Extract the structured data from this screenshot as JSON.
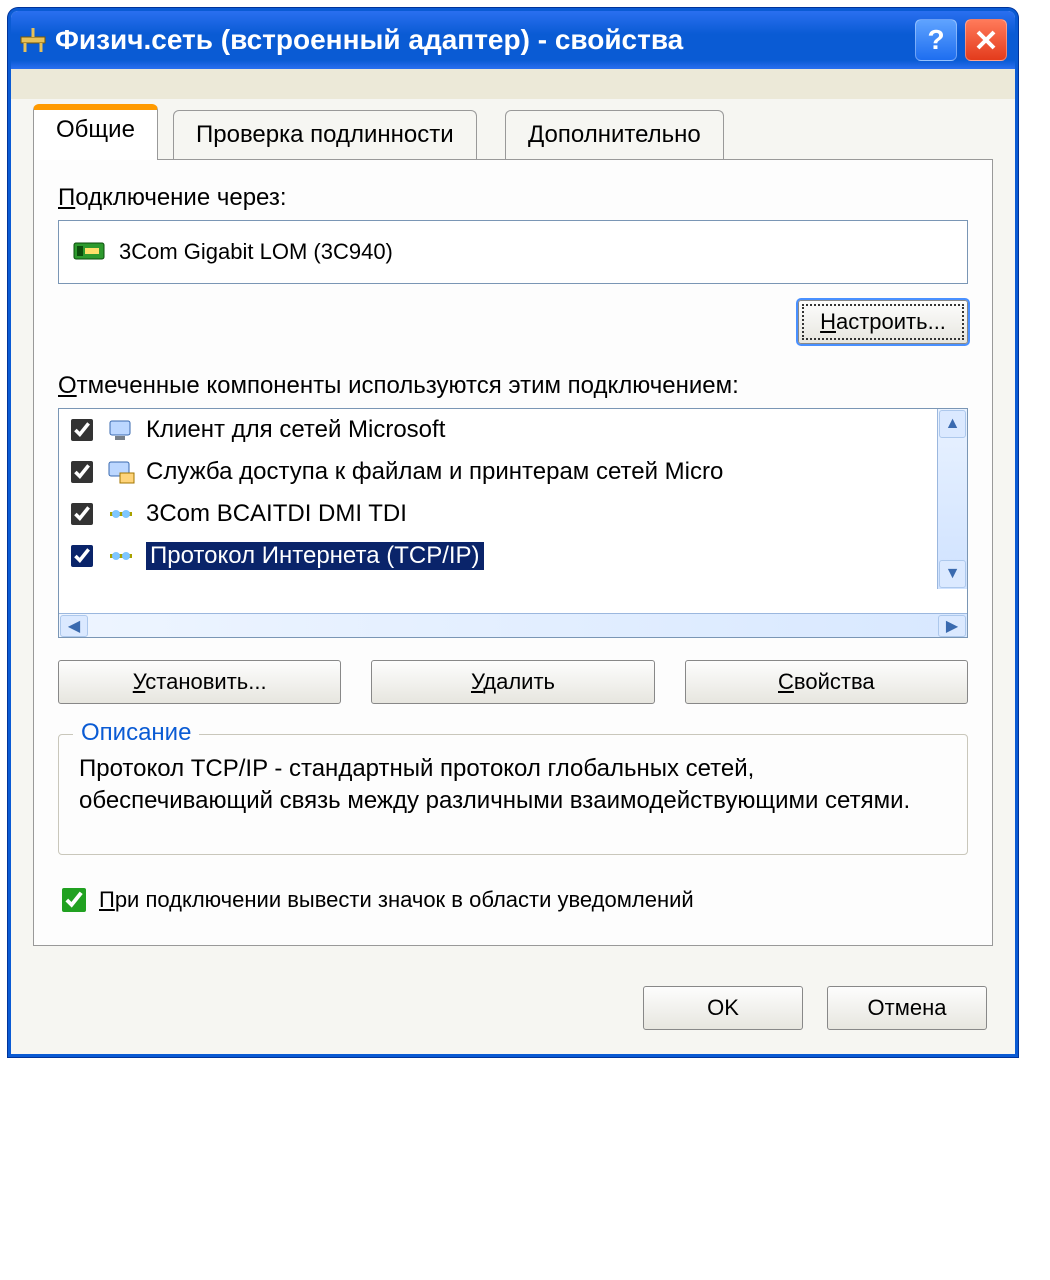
{
  "title": "Физич.сеть (встроенный адаптер) - свойства",
  "tabs": {
    "t1": "Общие",
    "t2": "Проверка подлинности",
    "t3": "Дополнительно"
  },
  "connect_label_pre": "П",
  "connect_label_post": "одключение через:",
  "adapter": "3Com Gigabit LOM (3C940)",
  "configure_pre": "Н",
  "configure_post": "астроить...",
  "components_pre": "О",
  "components_post": "тмеченные компоненты используются этим подключением:",
  "items": {
    "i0": "Клиент для сетей Microsoft",
    "i1": "Служба доступа к файлам и принтерам сетей Micro",
    "i2": "3Com BCAITDI DMI TDI",
    "i3": "Протокол Интернета (TCP/IP)"
  },
  "buttons": {
    "install_pre": "У",
    "install_post": "становить...",
    "remove_pre": "У",
    "remove_post": "далить",
    "props_pre": "С",
    "props_post": "войства"
  },
  "group_legend": "Описание",
  "description": "Протокол TCP/IP - стандартный протокол глобальных сетей, обеспечивающий связь между различными взаимодействующими сетями.",
  "tray_pre": "П",
  "tray_post": "ри подключении вывести значок в области уведомлений",
  "footer": {
    "ok": "OK",
    "cancel": "Отмена"
  }
}
